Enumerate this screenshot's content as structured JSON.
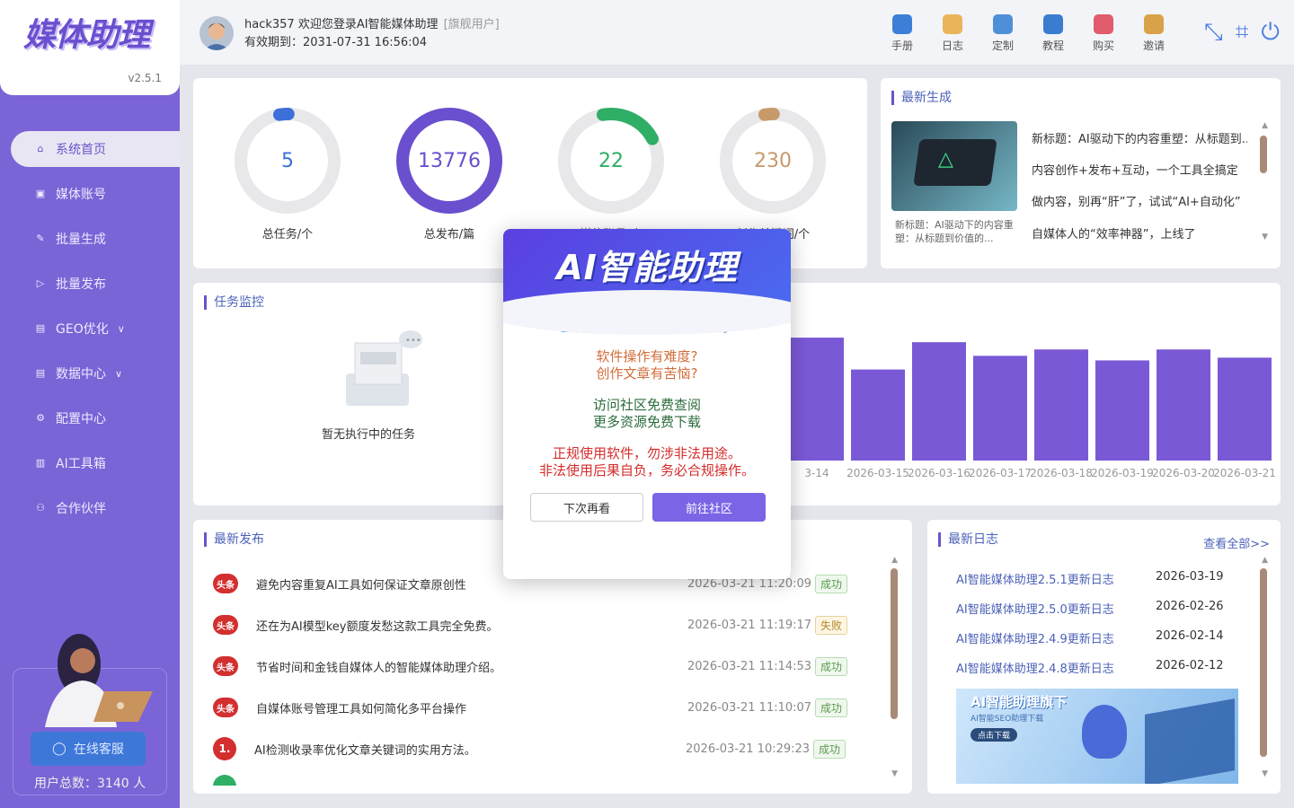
{
  "brand": {
    "logo": "媒体助理",
    "version": "v2.5.1"
  },
  "sidebar": {
    "items": [
      {
        "label": "系统首页",
        "icon": "home-icon"
      },
      {
        "label": "媒体账号",
        "icon": "account-icon"
      },
      {
        "label": "批量生成",
        "icon": "edit-icon"
      },
      {
        "label": "批量发布",
        "icon": "send-icon"
      },
      {
        "label": "GEO优化",
        "icon": "doc-icon"
      },
      {
        "label": "数据中心",
        "icon": "data-icon"
      },
      {
        "label": "配置中心",
        "icon": "gear-icon"
      },
      {
        "label": "AI工具箱",
        "icon": "toolbox-icon"
      },
      {
        "label": "合作伙伴",
        "icon": "partner-icon"
      }
    ],
    "service_label": "在线客服",
    "users_total": "用户总数：3140 人"
  },
  "header": {
    "user": "hack357 欢迎您登录AI智能媒体助理",
    "tier": "[旗舰用户]",
    "expire": "有效期到：2031-07-31 16:56:04",
    "tools": [
      "手册",
      "日志",
      "定制",
      "教程",
      "购买",
      "邀请"
    ]
  },
  "stats": [
    {
      "value": "5",
      "label": "总任务/个",
      "color": "#3d6fd8",
      "fraction": 0.03
    },
    {
      "value": "13776",
      "label": "总发布/篇",
      "color": "#6a4fcf",
      "fraction": 1.0
    },
    {
      "value": "22",
      "label": "媒体账号/个",
      "color": "#2fae66",
      "fraction": 0.2
    },
    {
      "value": "230",
      "label": "创作关键词/个",
      "color": "#c79a6a",
      "fraction": 0.03
    }
  ],
  "latest_gen": {
    "title": "最新生成",
    "thumb_caption": "新标题：AI驱动下的内容重塑：从标题到价值的...",
    "items": [
      "新标题：AI驱动下的内容重塑：从标题到...",
      "内容创作+发布+互动，一个工具全搞定",
      "做内容，别再“肝”了，试试“AI+自动化”",
      "自媒体人的“效率神器”，上线了"
    ]
  },
  "monitor": {
    "title": "任务监控",
    "empty": "暂无执行中的任务"
  },
  "chart_data": {
    "type": "bar",
    "categories": [
      "2026-03-14",
      "2026-03-15",
      "2026-03-16",
      "2026-03-17",
      "2026-03-18",
      "2026-03-19",
      "2026-03-20",
      "2026-03-21"
    ],
    "tick_labels": [
      "3-14",
      "2026-03-15",
      "2026-03-16",
      "2026-03-17",
      "2026-03-18",
      "2026-03-19",
      "2026-03-20",
      "2026-03-21"
    ],
    "values": [
      135,
      100,
      130,
      115,
      122,
      110,
      122,
      113
    ],
    "ylim": [
      0,
      140
    ],
    "color": "#7a59d6"
  },
  "latest_pub": {
    "title": "最新发布",
    "rows": [
      {
        "title": "避免内容重复AI工具如何保证文章原创性",
        "time": "2026-03-21 11:20:09",
        "status": "成功"
      },
      {
        "title": "还在为AI模型key额度发愁这款工具完全免费。",
        "time": "2026-03-21 11:19:17",
        "status": "失败"
      },
      {
        "title": "节省时间和金钱自媒体人的智能媒体助理介绍。",
        "time": "2026-03-21 11:14:53",
        "status": "成功"
      },
      {
        "title": "自媒体账号管理工具如何简化多平台操作",
        "time": "2026-03-21 11:10:07",
        "status": "成功"
      },
      {
        "title": "AI检测收录率优化文章关键词的实用方法。",
        "time": "2026-03-21 10:29:23",
        "status": "成功"
      }
    ],
    "badges": [
      "头条",
      "头条",
      "头条",
      "头条",
      "1."
    ]
  },
  "logs": {
    "title": "最新日志",
    "view_all": "查看全部>>",
    "rows": [
      {
        "title": "AI智能媒体助理2.5.1更新日志",
        "date": "2026-03-19"
      },
      {
        "title": "AI智能媒体助理2.5.0更新日志",
        "date": "2026-02-26"
      },
      {
        "title": "AI智能媒体助理2.4.9更新日志",
        "date": "2026-02-14"
      },
      {
        "title": "AI智能媒体助理2.4.8更新日志",
        "date": "2026-02-12"
      }
    ],
    "banner_title": "AI智能助理旗下",
    "banner_sub": "AI智能SEO助理下载",
    "banner_btn": "点击下载"
  },
  "modal": {
    "title": "AI智能助理",
    "line1": "全自动生成+发布，解放双手",
    "line2a": "软件操作有难度?",
    "line2b": "创作文章有苦恼?",
    "line3a": "访问社区免费查阅",
    "line3b": "更多资源免费下载",
    "line4a": "正规使用软件，勿涉非法用途。",
    "line4b": "非法使用后果自负，务必合规操作。",
    "btn_later": "下次再看",
    "btn_go": "前往社区"
  }
}
